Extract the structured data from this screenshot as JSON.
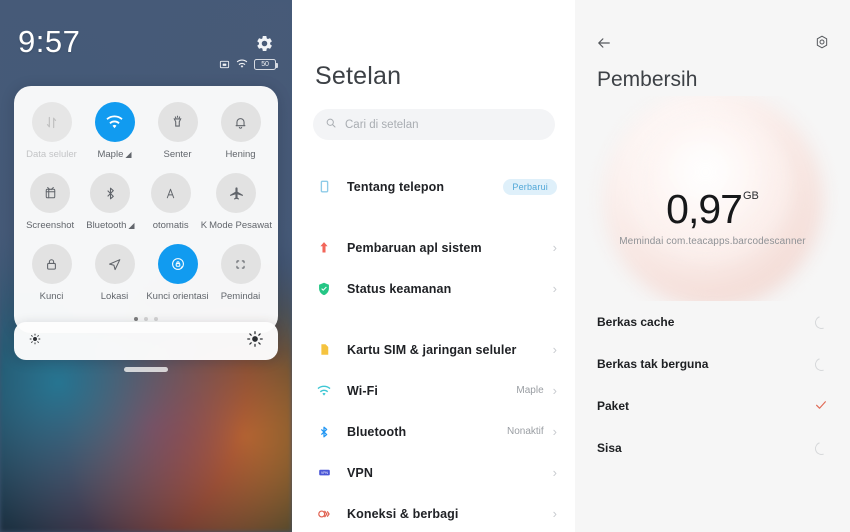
{
  "panel_shade": {
    "name": "quick-settings-shade",
    "status_bar": {
      "clock": "9:57",
      "gear_icon": "gear-icon",
      "icons": [
        "screenshot-icon",
        "wifi-icon",
        "battery-icon"
      ],
      "battery_level": "50"
    },
    "tiles_row1": [
      {
        "label": "Data seluler",
        "icon": "mobile-data-icon",
        "state": "off"
      },
      {
        "label": "Maple",
        "icon": "wifi-icon",
        "state": "on",
        "suffix": "signal-icon"
      },
      {
        "label": "Senter",
        "icon": "flashlight-icon",
        "state": "idle"
      },
      {
        "label": "Hening",
        "icon": "bell-icon",
        "state": "idle"
      }
    ],
    "tiles_row2": [
      {
        "label": "Screenshot",
        "icon": "screenshot-icon",
        "state": "idle"
      },
      {
        "label": "Bluetooth",
        "icon": "bluetooth-icon",
        "state": "idle",
        "suffix": "signal-icon"
      },
      {
        "label": "otomatis",
        "icon": "auto-brightness-icon",
        "state": "idle"
      },
      {
        "label": "Mode Pesawat",
        "icon": "airplane-icon",
        "state": "idle",
        "prefix": "K"
      }
    ],
    "tiles_row3": [
      {
        "label": "Kunci",
        "icon": "lock-icon",
        "state": "idle"
      },
      {
        "label": "Lokasi",
        "icon": "location-icon",
        "state": "idle"
      },
      {
        "label": "Kunci orientasi",
        "icon": "rotation-lock-icon",
        "state": "on"
      },
      {
        "label": "Pemindai",
        "icon": "scanner-icon",
        "state": "idle"
      }
    ],
    "page_dots": {
      "count": 3,
      "active": 0
    },
    "brightness": {
      "low_icon": "brightness-low-icon",
      "high_icon": "brightness-high-icon"
    },
    "accent_on": "#119bf0"
  },
  "panel_settings": {
    "title": "Setelan",
    "search": {
      "placeholder": "Cari di setelan",
      "value": "",
      "icon": "search-icon"
    },
    "groups": [
      {
        "items": [
          {
            "label": "Tentang telepon",
            "icon": "phone-info-icon",
            "icon_color": "#8ecbe8",
            "badge": "Perbarui",
            "chevron": false
          }
        ]
      },
      {
        "items": [
          {
            "label": "Pembaruan apl sistem",
            "icon": "system-update-icon",
            "icon_color": "#f2665a",
            "value": "",
            "chevron": true
          },
          {
            "label": "Status keamanan",
            "icon": "security-shield-icon",
            "icon_color": "#25c685",
            "value": "",
            "chevron": true
          }
        ]
      },
      {
        "items": [
          {
            "label": "Kartu SIM & jaringan seluler",
            "icon": "sim-card-icon",
            "icon_color": "#f5c33f",
            "value": "",
            "chevron": true
          },
          {
            "label": "Wi-Fi",
            "icon": "wifi-icon",
            "icon_color": "#3fc7d4",
            "value": "Maple",
            "chevron": true
          },
          {
            "label": "Bluetooth",
            "icon": "bluetooth-icon",
            "icon_color": "#2196f3",
            "value": "Nonaktif",
            "chevron": true
          },
          {
            "label": "VPN",
            "icon": "vpn-icon",
            "icon_color": "#4a56d6",
            "value": "",
            "chevron": true
          },
          {
            "label": "Koneksi & berbagi",
            "icon": "sharing-icon",
            "icon_color": "#e0604f",
            "value": "",
            "chevron": true
          }
        ]
      }
    ]
  },
  "panel_cleaner": {
    "back_icon": "back-arrow-icon",
    "settings_icon": "gear-icon",
    "title": "Pembersih",
    "size_value": "0,97",
    "size_unit": "GB",
    "scan_status": "Memindai com.teacapps.barcodescanner",
    "items": [
      {
        "label": "Berkas cache",
        "status": "scanning"
      },
      {
        "label": "Berkas tak berguna",
        "status": "scanning"
      },
      {
        "label": "Paket",
        "status": "done"
      },
      {
        "label": "Sisa",
        "status": "scanning"
      }
    ],
    "check_color": "#e06a55"
  }
}
